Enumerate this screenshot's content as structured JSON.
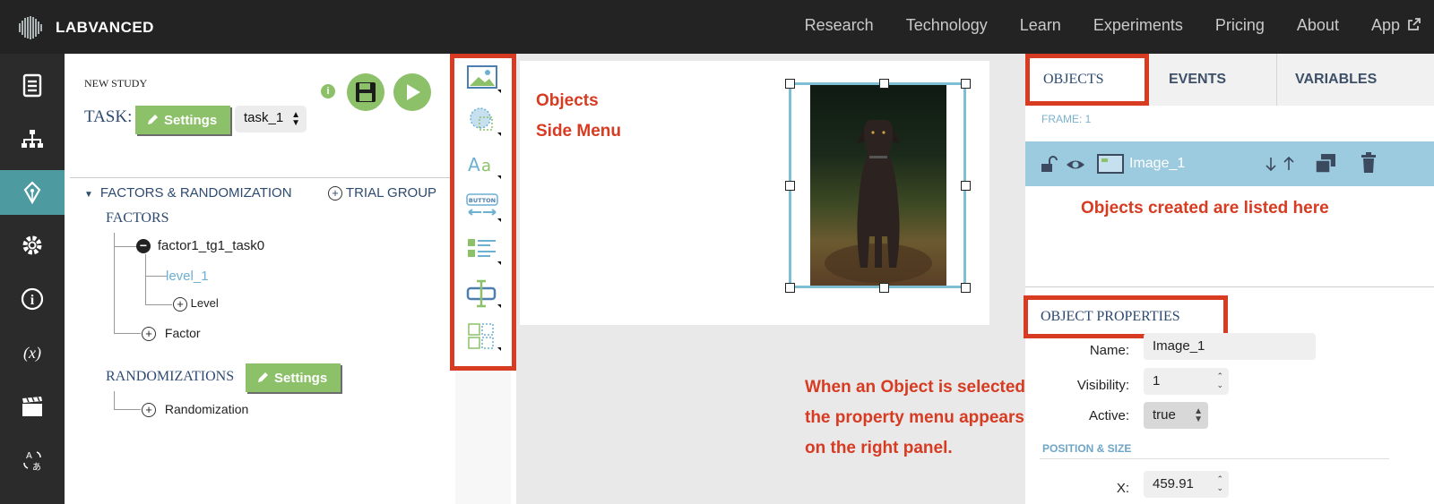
{
  "brand": {
    "name": "LABVANCED"
  },
  "nav": {
    "items": [
      "Research",
      "Technology",
      "Learn",
      "Experiments",
      "Pricing",
      "About",
      "App"
    ]
  },
  "left_panel": {
    "study_title": "NEW STUDY",
    "task_label": "TASK:",
    "settings_label": "Settings",
    "task_value": "task_1",
    "info_icon": "i",
    "factors_randomization": "FACTORS & RANDOMIZATION",
    "trial_group": "TRIAL GROUP",
    "factors_head": "FACTORS",
    "factor_name": "factor1_tg1_task0",
    "level_name": "level_1",
    "add_level": "Level",
    "add_factor": "Factor",
    "randomizations_head": "RANDOMIZATIONS",
    "randomization_settings": "Settings",
    "add_randomization": "Randomization"
  },
  "annotations": {
    "objects_menu_line1": "Objects",
    "objects_menu_line2": "Side Menu",
    "selected_line1": "When an Object is selected,",
    "selected_line2": "the property menu appears",
    "selected_line3": "on the right panel.",
    "objects_listed": "Objects created are listed here"
  },
  "right_panel": {
    "tabs": [
      "OBJECTS",
      "EVENTS",
      "VARIABLES"
    ],
    "frame_label": "FRAME: 1",
    "object_name": "Image_1",
    "properties_head": "OBJECT PROPERTIES",
    "name_label": "Name:",
    "name_value": "Image_1",
    "visibility_label": "Visibility:",
    "visibility_value": "1",
    "active_label": "Active:",
    "active_value": "true",
    "position_size": "POSITION & SIZE",
    "x_label": "X:",
    "x_value": "459.91"
  },
  "colors": {
    "accent_green": "#8cc069",
    "teal": "#4d9aa1",
    "annotation_red": "#d73b21",
    "object_row": "#9ccbe0"
  }
}
